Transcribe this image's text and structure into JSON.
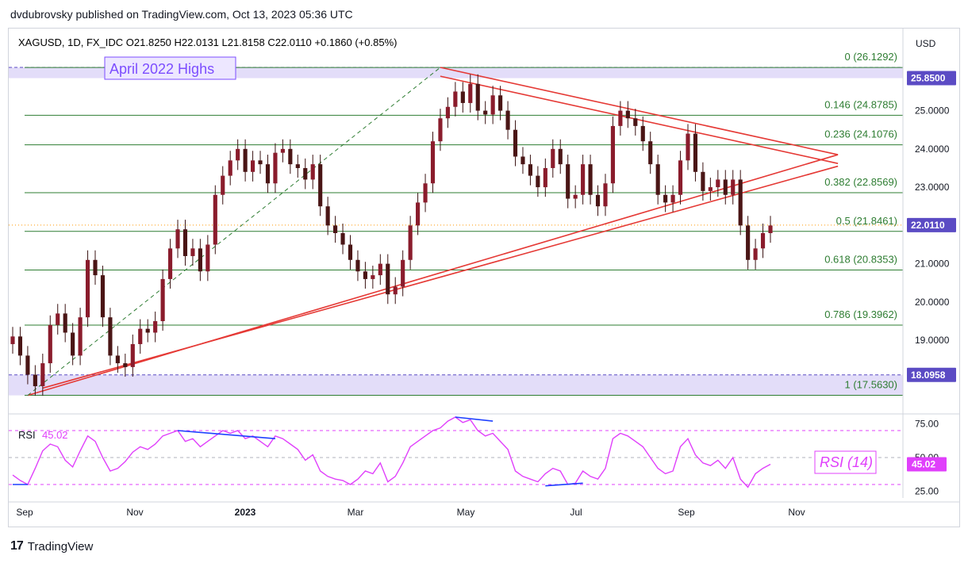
{
  "header": {
    "credit": "dvdubrovsky published on TradingView.com, Oct 13, 2023 05:36 UTC",
    "symbol_line": "XAGUSD, 1D, FX_IDC  O21.8250  H22.0131  L21.8158  C22.0110  +0.1860 (+0.85%)",
    "currency": "USD"
  },
  "footer": {
    "brand": "TradingView",
    "mark": "17"
  },
  "annotations": {
    "april_highs": "April 2022 Highs",
    "rsi_box": "RSI (14)",
    "rsi_label": "RSI",
    "rsi_value_label": "45.02"
  },
  "colors": {
    "fib": "#2e7d32",
    "trend": "#e53935",
    "rsi": "#e040fb",
    "zone": "#d9d2f7",
    "divergence": "#1e40ff",
    "candle_up": "#8a1c2c",
    "candle_down": "#4a1515"
  },
  "chart_data": {
    "type": "candlestick",
    "symbol": "XAGUSD",
    "timeframe": "1D",
    "price_axis": {
      "ylim": [
        17.2,
        26.4
      ],
      "ticks": [
        "25.0000",
        "24.0000",
        "23.0000",
        "22.0000",
        "21.0000",
        "20.0000",
        "19.0000"
      ],
      "tick_values": [
        25,
        24,
        23,
        22,
        21,
        20,
        19
      ],
      "badges": [
        {
          "label": "25.8500",
          "value": 25.85,
          "color": "#5b4bc4"
        },
        {
          "label": "22.0110",
          "value": 22.011,
          "color": "#5b4bc4"
        },
        {
          "label": "18.0958",
          "value": 18.0958,
          "color": "#5b4bc4"
        }
      ]
    },
    "x_axis": {
      "labels": [
        "Sep",
        "Nov",
        "2023",
        "Mar",
        "May",
        "Jul",
        "Sep",
        "Nov"
      ],
      "label_months": [
        0,
        2,
        4,
        6,
        8,
        10,
        12,
        14
      ]
    },
    "fibonacci": [
      {
        "label": "0 (26.1292)",
        "value": 26.1292
      },
      {
        "label": "0.146 (24.8785)",
        "value": 24.8785
      },
      {
        "label": "0.236 (24.1076)",
        "value": 24.1076
      },
      {
        "label": "0.382 (22.8569)",
        "value": 22.8569
      },
      {
        "label": "0.5 (21.8461)",
        "value": 21.8461
      },
      {
        "label": "0.618 (20.8353)",
        "value": 20.8353
      },
      {
        "label": "0.786 (19.3962)",
        "value": 19.3962
      },
      {
        "label": "1 (17.5630)",
        "value": 17.563
      }
    ],
    "zones": [
      {
        "from": 25.85,
        "to": 26.13
      },
      {
        "from": 17.56,
        "to": 18.0958
      }
    ],
    "last_price": 22.011,
    "closes": [
      19.1,
      18.6,
      18.1,
      17.8,
      18.4,
      19.4,
      19.7,
      19.2,
      18.6,
      19.6,
      21.1,
      20.7,
      19.6,
      18.6,
      18.4,
      18.3,
      18.9,
      19.3,
      19.2,
      19.5,
      20.6,
      21.4,
      21.9,
      21.2,
      21.4,
      20.8,
      21.5,
      22.8,
      23.3,
      23.7,
      24.0,
      23.4,
      23.7,
      23.6,
      23.1,
      23.9,
      24.0,
      23.6,
      23.5,
      23.2,
      23.6,
      22.5,
      22.0,
      21.8,
      21.5,
      21.1,
      20.8,
      20.6,
      20.7,
      21.0,
      20.2,
      20.4,
      21.1,
      22.0,
      22.6,
      23.1,
      24.2,
      24.8,
      25.1,
      25.5,
      25.2,
      25.7,
      25.0,
      24.9,
      25.4,
      25.0,
      24.5,
      23.8,
      23.6,
      23.3,
      23.0,
      23.5,
      24.0,
      23.6,
      22.7,
      22.8,
      23.6,
      22.8,
      22.5,
      23.1,
      24.6,
      25.0,
      24.8,
      24.6,
      24.2,
      23.6,
      22.8,
      22.6,
      22.8,
      23.7,
      24.4,
      23.4,
      22.9,
      23.0,
      23.2,
      22.8,
      23.2,
      22.0,
      21.1,
      21.4,
      21.8,
      22.0
    ],
    "rsi": {
      "name": "RSI (14)",
      "ticks": [
        "75.00",
        "50.00",
        "25.00"
      ],
      "tick_values": [
        75,
        50,
        25
      ],
      "levels": [
        70,
        30
      ],
      "ylim": [
        20,
        80
      ],
      "last": 45.02,
      "values": [
        37,
        33,
        30,
        42,
        55,
        60,
        58,
        48,
        43,
        55,
        66,
        62,
        50,
        40,
        42,
        47,
        54,
        58,
        56,
        60,
        66,
        68,
        70,
        62,
        64,
        58,
        62,
        66,
        70,
        68,
        70,
        64,
        66,
        62,
        58,
        66,
        64,
        60,
        56,
        48,
        52,
        40,
        36,
        34,
        33,
        30,
        34,
        40,
        38,
        46,
        32,
        36,
        46,
        58,
        62,
        66,
        70,
        72,
        77,
        80,
        76,
        78,
        70,
        66,
        68,
        62,
        56,
        40,
        36,
        34,
        32,
        38,
        42,
        40,
        30,
        31,
        40,
        36,
        34,
        42,
        64,
        68,
        66,
        62,
        58,
        50,
        42,
        38,
        40,
        58,
        64,
        52,
        46,
        44,
        48,
        42,
        50,
        34,
        28,
        38,
        42,
        45
      ]
    }
  }
}
